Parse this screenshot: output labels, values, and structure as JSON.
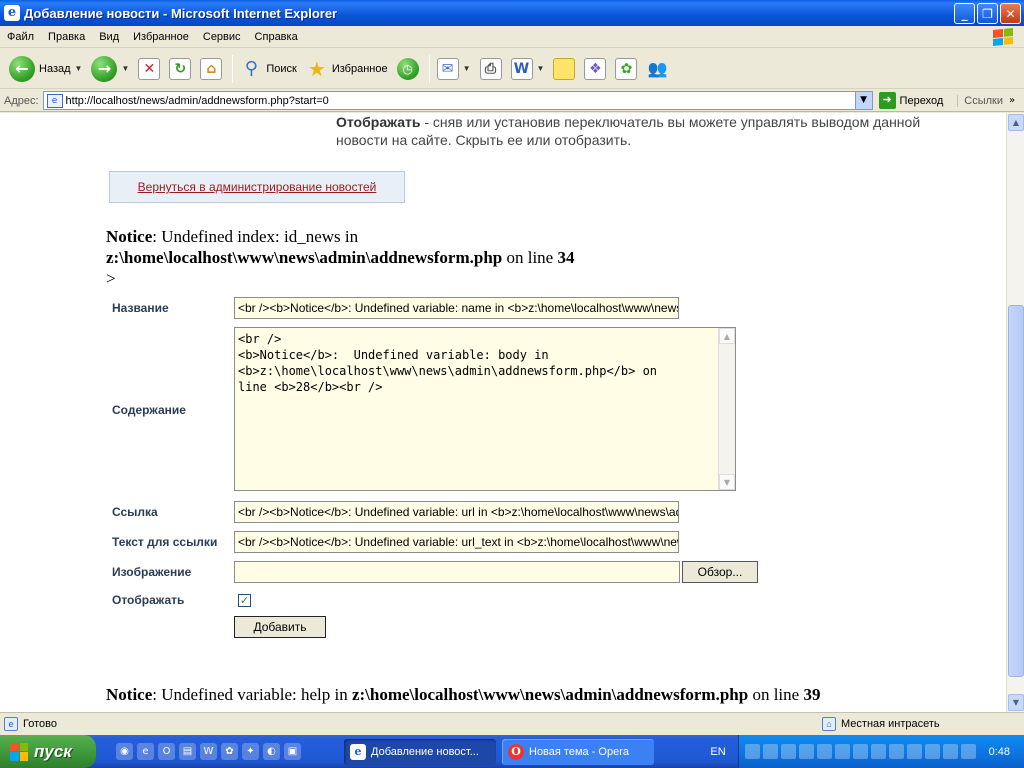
{
  "window": {
    "title": "Добавление новости - Microsoft Internet Explorer",
    "minimize": "_",
    "maximize": "❐",
    "close": "✕"
  },
  "menu": [
    "Файл",
    "Правка",
    "Вид",
    "Избранное",
    "Сервис",
    "Справка"
  ],
  "toolbar": {
    "back_label": "Назад",
    "search_label": "Поиск",
    "favorites_label": "Избранное"
  },
  "address": {
    "label": "Адрес:",
    "url": "http://localhost/news/admin/addnewsform.php?start=0",
    "go_label": "Переход",
    "links_label": "Ссылки"
  },
  "page": {
    "help_bold": "Отображать",
    "help_text": " - сняв или установив переключатель вы можете управлять выводом данной новости на сайте. Скрыть ее или отобразить.",
    "back_link": "Вернуться в администрирование новостей",
    "notice1": {
      "word": "Notice",
      "text": ": Undefined index: id_news in",
      "path": "z:\\home\\localhost\\www\\news\\admin\\addnewsform.php",
      "on_line": " on line ",
      "line": "34",
      "gt": ">"
    },
    "form": {
      "name_label": "Название",
      "name_value": "<br /><b>Notice</b>:  Undefined variable: name in <b>z:\\home\\localhost\\www\\news\\admin\\addnewsform.php</b>",
      "body_label": "Содержание",
      "body_value": "<br />\n<b>Notice</b>:  Undefined variable: body in\n<b>z:\\home\\localhost\\www\\news\\admin\\addnewsform.php</b> on\nline <b>28</b><br />",
      "url_label": "Ссылка",
      "url_value": "<br /><b>Notice</b>:  Undefined variable: url in <b>z:\\home\\localhost\\www\\news\\admin\\addnewsform.php</b>",
      "url_text_label": "Текст для ссылки",
      "url_text_value": "<br /><b>Notice</b>:  Undefined variable: url_text in <b>z:\\home\\localhost\\www\\news\\admin\\addnewsform.php</b>",
      "image_label": "Изображение",
      "browse_label": "Обзор...",
      "show_label": "Отображать",
      "show_checked": true,
      "submit_label": "Добавить"
    },
    "notice2": {
      "word": "Notice",
      "text": ": Undefined variable: help in ",
      "path": "z:\\home\\localhost\\www\\news\\admin\\addnewsform.php",
      "on_line": " on line ",
      "line": "39"
    }
  },
  "status": {
    "text": "Готово",
    "zone": "Местная интрасеть"
  },
  "taskbar": {
    "start_label": "пуск",
    "task1": "Добавление новост...",
    "task2": "Новая тема - Opera",
    "lang": "EN",
    "clock": "0:48"
  },
  "icons": {
    "back": "back-arrow-icon",
    "forward": "forward-arrow-icon",
    "stop": "stop-icon",
    "refresh": "refresh-icon",
    "home": "home-icon"
  }
}
